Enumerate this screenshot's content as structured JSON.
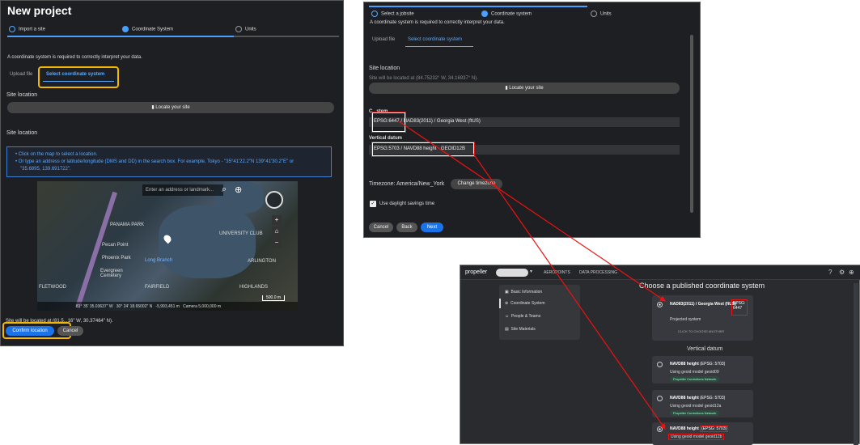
{
  "panel1": {
    "title": "New project",
    "steps": [
      "Import a site",
      "Coordinate System",
      "Units"
    ],
    "intro": "A coordinate system is required to correctly interpret your data.",
    "tabs": [
      "Upload file",
      "Select coordinate system"
    ],
    "site_location_label": "Site location",
    "locate_button": "Locate your site",
    "site_location_label2": "Site location",
    "info_line1": "Click on the map to select a location.",
    "info_line2": "Or type an address or latitude/longitude (DMS and DD) in the search box. For example, Tokyo - \"35°41'22.2\"N 139°41'30.2\"E\" or",
    "info_line3": "\"35.6895, 139.691722\".",
    "search_placeholder": "Enter an address or landmark...",
    "map_labels": [
      "PANAMA PARK",
      "Pecan Point",
      "Phoenix Park",
      "Evergreen Cemetery",
      "UNIVERSITY CLUB",
      "Long Branch",
      "ARLINGTON",
      "FLETWOOD",
      "FAIRFIELD",
      "HIGHLANDS"
    ],
    "map_status": [
      "81° 35' 35.03637\" W",
      "30° 24' 18.65002\" N",
      "-5,993,451 m",
      "Camera 5,000,000 m"
    ],
    "map_scale": "500.0 m",
    "site_located_at": "Site will be located at (81.5...16\" W, 30.37464\" N).",
    "confirm_button": "Confirm location",
    "cancel_button": "Cancel"
  },
  "panel2": {
    "steps": [
      "Select a jobsite",
      "Coordinate system",
      "Units"
    ],
    "intro": "A coordinate system is required to correctly interpret your data.",
    "tabs": [
      "Upload file",
      "Select coordinate system"
    ],
    "site_location_label": "Site location",
    "site_located_at": "Site will be located at (84.75232° W, 34.16937° N).",
    "locate_button": "Locate your site",
    "horizontal_label": "C...stem",
    "horizontal_value_code": "EPSG:6447",
    "horizontal_value_rest": " / NAD83(2011) / Georgia West (ftUS)",
    "vertical_label": "Vertical datum",
    "vertical_value": "EPSG:5703 / NAVD88 height - GEOID12B",
    "timezone_text": "Timezone: America/New_York",
    "change_timezone_button": "Change timezone",
    "dst_label": "Use daylight savings time",
    "cancel_button": "Cancel",
    "back_button": "Back",
    "next_button": "Next"
  },
  "panel3": {
    "brand": "propeller",
    "nav": [
      "AEROPOINTS",
      "DATA PROCESSING"
    ],
    "heading": "Choose a published coordinate system",
    "sidebar": [
      "Basic Information",
      "Coordinate System",
      "People & Teams",
      "Site Materials"
    ],
    "horizontal_option": {
      "name": "NAD83(2011) / Georgia West (ftUS)",
      "code": "EPSG: 6447",
      "type": "Projected system",
      "action": "CLICK TO CHOOSE ANOTHER"
    },
    "vertical_heading": "Vertical datum",
    "vertical_options": [
      {
        "name": "NAVD88 height",
        "code": "(EPSG: 5703)",
        "sub": "Using geoid model geoid09",
        "badge": "Propeller Corrections Network"
      },
      {
        "name": "NAVD88 height",
        "code": "(EPSG: 5703)",
        "sub": "Using geoid model geoid12a",
        "badge": "Propeller Corrections Network"
      },
      {
        "name": "NAVD88 height",
        "code": "(EPSG: 5703)",
        "sub": "Using geoid model geoid12b",
        "badge": "Propeller Corrections Network"
      }
    ]
  },
  "colors": {
    "accent": "#1a73e8",
    "highlight_yellow": "#f5b800",
    "highlight_red": "#e11111"
  }
}
